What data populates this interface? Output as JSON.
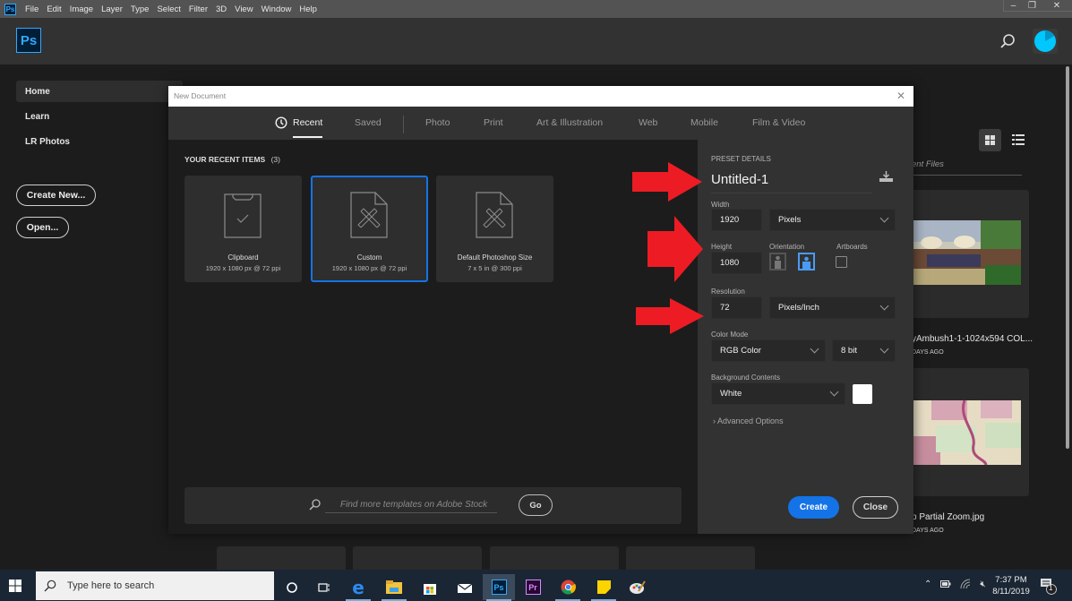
{
  "menubar": {
    "app_icon": "Ps",
    "items": [
      "File",
      "Edit",
      "Image",
      "Layer",
      "Type",
      "Select",
      "Filter",
      "3D",
      "View",
      "Window",
      "Help"
    ],
    "window_controls": [
      "minimize",
      "restore",
      "close"
    ]
  },
  "header": {
    "logo": "Ps",
    "search_icon": "search-icon",
    "cc_icon": "creative-cloud-icon"
  },
  "leftnav": {
    "items": [
      {
        "label": "Home",
        "active": true
      },
      {
        "label": "Learn",
        "active": false
      },
      {
        "label": "LR Photos",
        "active": false
      }
    ],
    "create_new": "Create New...",
    "open": "Open..."
  },
  "recent_files": {
    "label": "ent Files",
    "files": [
      {
        "name": "yAmbush1-1-1024x594 COL...",
        "time": "DAYS AGO"
      },
      {
        "name": "p Partial Zoom.jpg",
        "time": "DAYS AGO"
      }
    ]
  },
  "dialog": {
    "title": "New Document",
    "close_glyph": "✕",
    "tabs": [
      {
        "label": "Recent",
        "active": true
      },
      {
        "label": "Saved",
        "active": false
      },
      {
        "label": "Photo",
        "active": false
      },
      {
        "label": "Print",
        "active": false
      },
      {
        "label": "Art & Illustration",
        "active": false
      },
      {
        "label": "Web",
        "active": false
      },
      {
        "label": "Mobile",
        "active": false
      },
      {
        "label": "Film & Video",
        "active": false
      }
    ],
    "recent_header": "YOUR RECENT ITEMS",
    "recent_count": "(3)",
    "presets": [
      {
        "name": "Clipboard",
        "size": "1920 x 1080 px @ 72 ppi",
        "selected": false,
        "icon": "clipboard-icon"
      },
      {
        "name": "Custom",
        "size": "1920 x 1080 px @ 72 ppi",
        "selected": true,
        "icon": "document-icon"
      },
      {
        "name": "Default Photoshop Size",
        "size": "7 x 5 in @ 300 ppi",
        "selected": false,
        "icon": "document-icon"
      }
    ],
    "stock_search": {
      "placeholder": "Find more templates on Adobe Stock",
      "go": "Go"
    },
    "details": {
      "header": "PRESET DETAILS",
      "doc_name": "Untitled-1",
      "width_label": "Width",
      "width": "1920",
      "width_unit": "Pixels",
      "height_label": "Height",
      "height": "1080",
      "orientation_label": "Orientation",
      "orientation": "landscape",
      "artboards_label": "Artboards",
      "artboards": false,
      "resolution_label": "Resolution",
      "resolution": "72",
      "resolution_unit": "Pixels/Inch",
      "color_mode_label": "Color Mode",
      "color_mode": "RGB Color",
      "bit_depth": "8 bit",
      "bg_label": "Background Contents",
      "bg": "White",
      "bg_color": "#ffffff",
      "advanced": "Advanced Options",
      "create": "Create",
      "close": "Close"
    }
  },
  "annotations": {
    "arrow_color": "#ed1c24",
    "targets": [
      "document-name",
      "height",
      "resolution"
    ]
  },
  "taskbar": {
    "search_placeholder": "Type here to search",
    "apps": [
      "cortana",
      "task-view",
      "edge",
      "file-explorer",
      "store",
      "mail",
      "photoshop",
      "premiere",
      "chrome",
      "sticky-notes",
      "paint"
    ],
    "time": "7:37 PM",
    "date": "8/11/2019",
    "notification_count": "1"
  },
  "colors": {
    "accent": "#1473e6",
    "ps_blue": "#31a8ff"
  }
}
